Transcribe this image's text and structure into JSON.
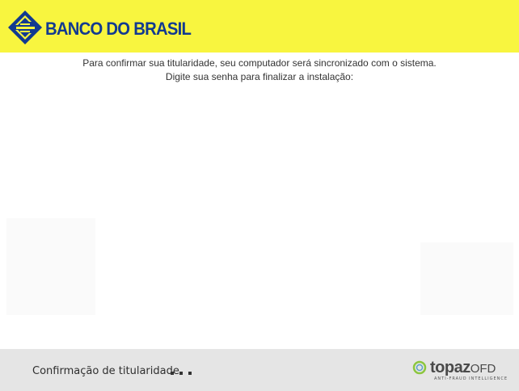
{
  "header": {
    "brand_name": "BANCO DO BRASIL",
    "background_color": "#f8f53f",
    "brand_color": "#123a90"
  },
  "message": {
    "line1": "Para confirmar sua titularidade, seu computador será sincronizado com o sistema.",
    "line2": "Digite sua senha para finalizar a instalação:"
  },
  "footer": {
    "label": "Confirmação de titularidade",
    "progress_icon": "loading-dots-icon",
    "vendor": {
      "name": "topaz",
      "suffix": "OFD",
      "tagline": "ANTI-FRAUD INTELLIGENCE"
    }
  }
}
